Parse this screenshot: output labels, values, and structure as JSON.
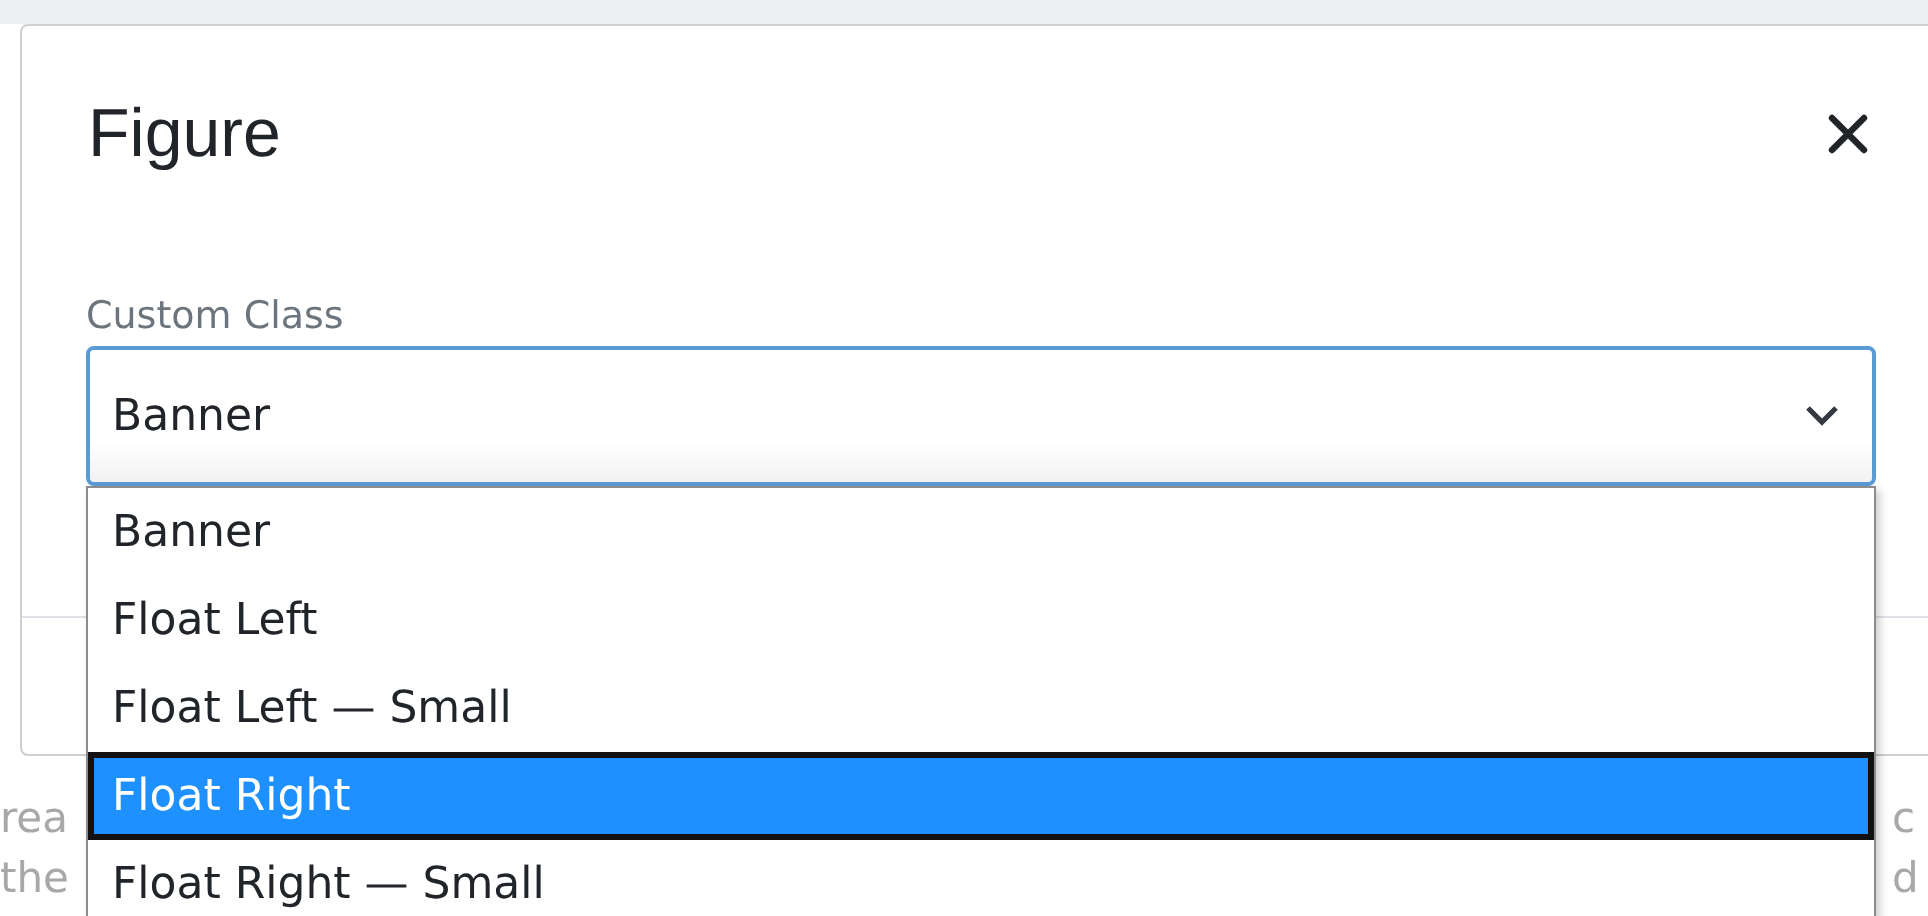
{
  "dialog": {
    "title": "Figure"
  },
  "field": {
    "label": "Custom Class",
    "value": "Banner",
    "expanded": true
  },
  "options": [
    {
      "label": "Banner",
      "selected": false
    },
    {
      "label": "Float Left",
      "selected": false
    },
    {
      "label": "Float Left — Small",
      "selected": false
    },
    {
      "label": "Float Right",
      "selected": true
    },
    {
      "label": "Float Right — Small",
      "selected": false
    }
  ],
  "background_text": {
    "left": [
      "rea",
      "the"
    ],
    "right": [
      "c",
      "d"
    ]
  }
}
